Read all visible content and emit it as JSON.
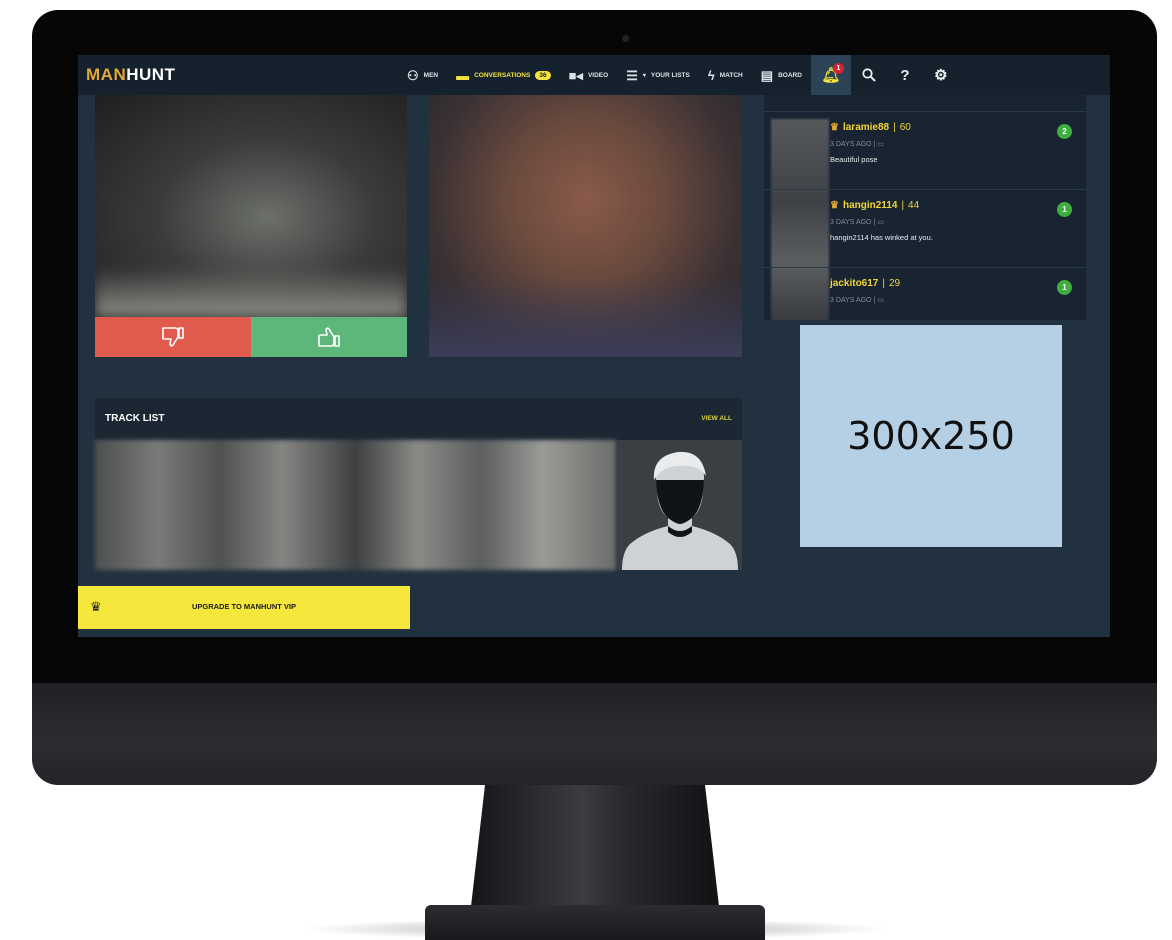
{
  "brand": {
    "logo_part1": "MAN",
    "logo_part2": "HUNT"
  },
  "nav": {
    "items": [
      {
        "label": "MEN",
        "icon": "men-icon"
      },
      {
        "label": "CONVERSATIONS",
        "icon": "chat-icon",
        "badge": "36",
        "active": true
      },
      {
        "label": "VIDEO",
        "icon": "video-icon"
      },
      {
        "label": "YOUR LISTS",
        "icon": "list-icon"
      },
      {
        "label": "MATCH",
        "icon": "lightning-icon"
      },
      {
        "label": "BOARD",
        "icon": "board-icon"
      }
    ],
    "notification_count": "1",
    "help_label": "?"
  },
  "conversations": [
    {
      "name": "laramie88",
      "separator": "|",
      "age": "60",
      "meta": "3 DAYS AGO |",
      "message": "Beautiful pose",
      "unread": "2"
    },
    {
      "name": "hangin2114",
      "separator": "|",
      "age": "44",
      "meta": "3 DAYS AGO |",
      "message": "hangin2114 has winked at you.",
      "unread": "1"
    },
    {
      "name": "jackito617",
      "separator": "|",
      "age": "29",
      "meta": "3 DAYS AGO |",
      "message": "",
      "unread": "1"
    }
  ],
  "ad": {
    "label": "300x250"
  },
  "track_list": {
    "title": "TRACK LIST",
    "view_all": "VIEW ALL"
  },
  "upgrade": {
    "label": "UPGRADE TO MANHUNT VIP"
  },
  "colors": {
    "accent_yellow": "#f7e33a",
    "brand_orange": "#e4a73b",
    "nav_bg": "#15212c",
    "page_bg": "#22313f",
    "dislike_red": "#e05a4e",
    "like_green": "#5db77a",
    "unread_green": "#3fae3f",
    "ad_blue": "#b5d0e5"
  }
}
